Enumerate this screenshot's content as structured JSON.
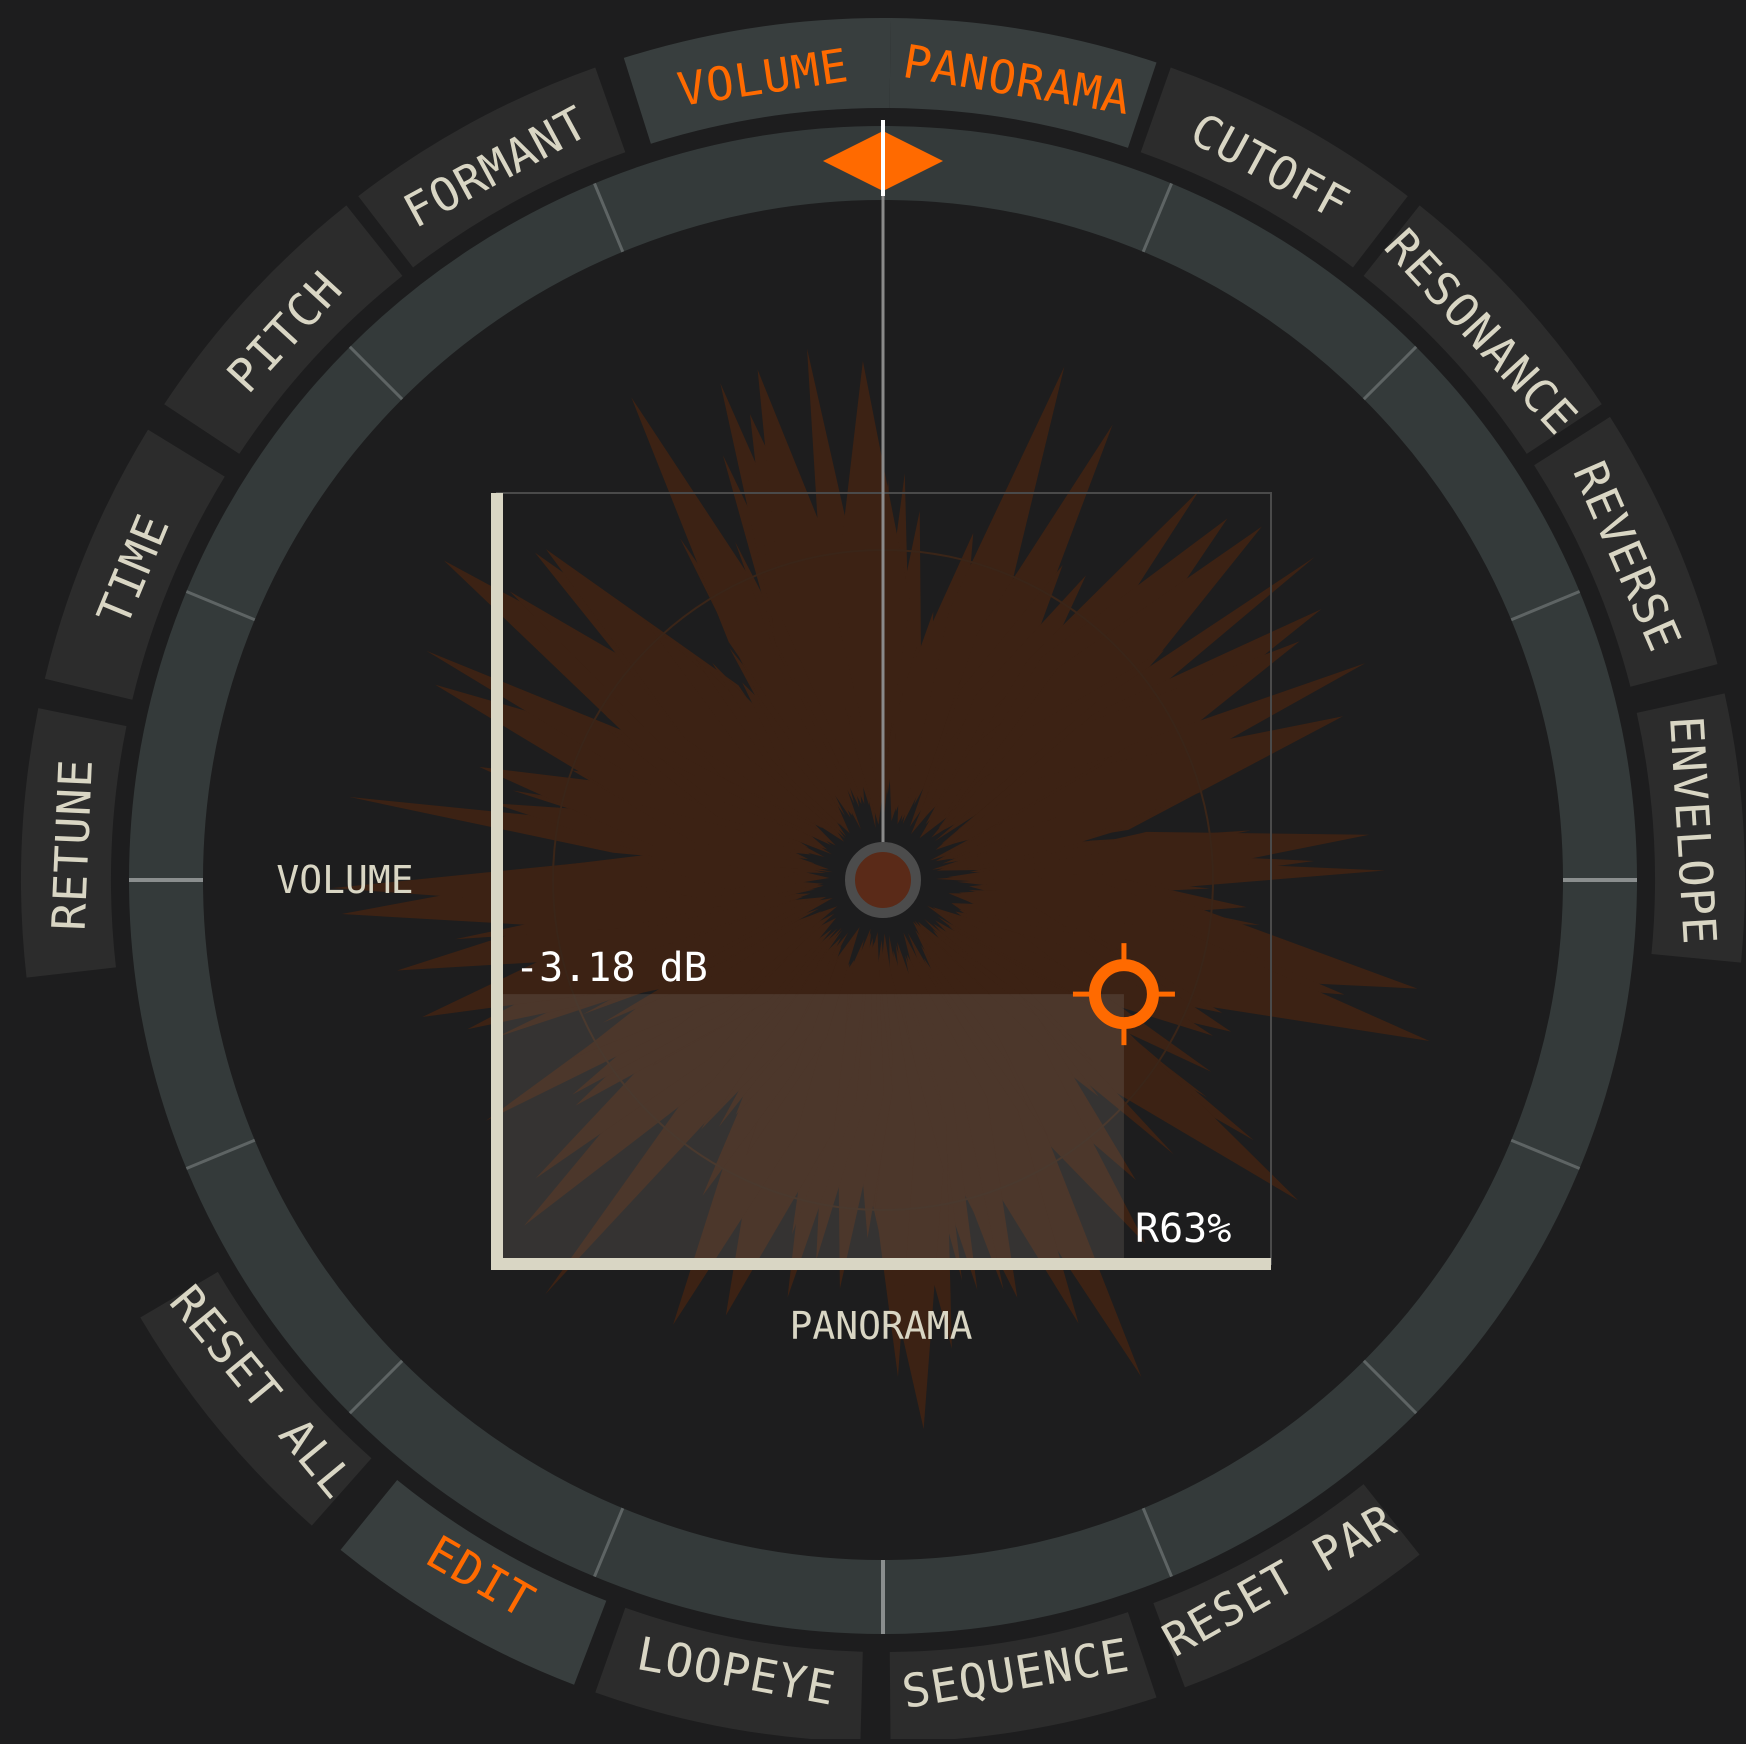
{
  "ring_buttons": {
    "top_left": [
      {
        "key": "volume",
        "label": "VOLUME",
        "active": true
      },
      {
        "key": "formant",
        "label": "FORMANT",
        "active": false
      },
      {
        "key": "pitch",
        "label": "PITCH",
        "active": false
      },
      {
        "key": "time",
        "label": "TIME",
        "active": false
      },
      {
        "key": "retune",
        "label": "RETUNE",
        "active": false
      }
    ],
    "top_right": [
      {
        "key": "panorama",
        "label": "PANORAMA",
        "active": true
      },
      {
        "key": "cutoff",
        "label": "CUTOFF",
        "active": false
      },
      {
        "key": "resonance",
        "label": "RESONANCE",
        "active": false
      },
      {
        "key": "reverse",
        "label": "REVERSE",
        "active": false
      },
      {
        "key": "envelope",
        "label": "ENVELOPE",
        "active": false
      }
    ],
    "bottom_left": [
      {
        "key": "reset-all",
        "label": "RESET ALL",
        "active": false
      },
      {
        "key": "edit",
        "label": "EDIT",
        "active": true
      },
      {
        "key": "loopeye",
        "label": "LOOPEYE",
        "active": false
      }
    ],
    "bottom_right": [
      {
        "key": "sequence",
        "label": "SEQUENCE",
        "active": false
      },
      {
        "key": "reset-par",
        "label": "RESET PAR",
        "active": false
      }
    ]
  },
  "xy_pad": {
    "y_axis_label": "VOLUME",
    "x_axis_label": "PANORAMA",
    "volume_readout": "-3.18 dB",
    "panorama_readout": "R63%",
    "handle_x_fraction": 0.81,
    "handle_y_fraction": 0.65
  },
  "playhead_fraction": 0.0,
  "colors": {
    "background": "#1d1d1e",
    "ring": "#343a3a",
    "button": "#2c2c2c",
    "button_active": "#383e3e",
    "accent": "#ff6a00",
    "label": "#d9d6c4",
    "waveform": "#3c2214"
  }
}
